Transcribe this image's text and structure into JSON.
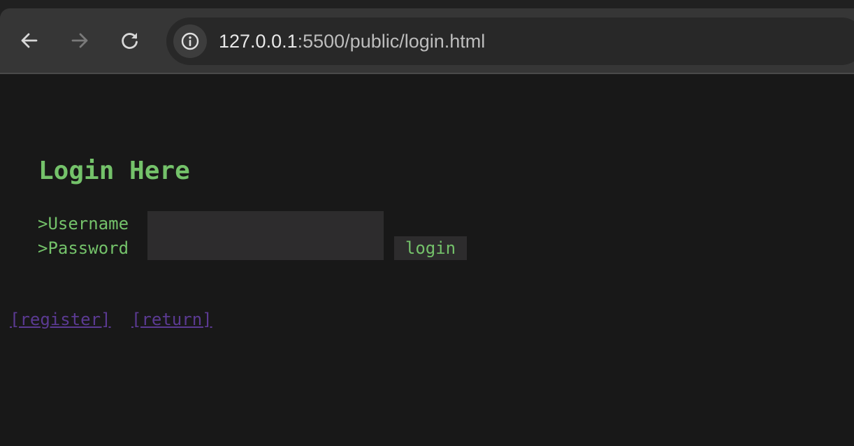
{
  "browser": {
    "url_host": "127.0.0.1",
    "url_rest": ":5500/public/login.html",
    "icons": {
      "back": "arrow-left-icon",
      "forward": "arrow-right-icon",
      "reload": "reload-icon",
      "site_info": "info-icon"
    }
  },
  "page": {
    "title": "Login Here",
    "username_label": ">Username",
    "password_label": ">Password",
    "username_value": "",
    "password_value": "",
    "login_button": "login",
    "register_link": "[register]",
    "return_link": "[return]"
  },
  "colors": {
    "background": "#181818",
    "text_green": "#74c26a",
    "field_bg": "#2d2c2d",
    "link_purple": "#5b3a92"
  }
}
